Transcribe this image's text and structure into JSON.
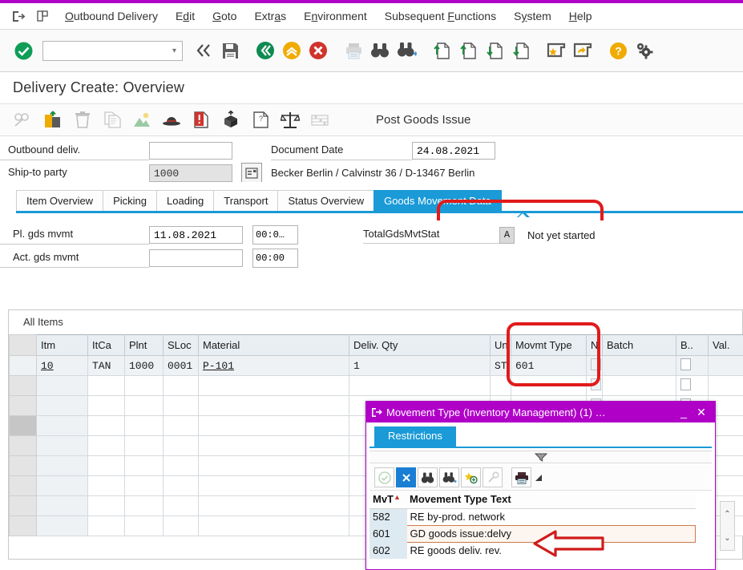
{
  "menu": {
    "icons": [
      "exit-icon",
      "new-session-icon"
    ],
    "items": [
      {
        "label": "Outbound Delivery",
        "accel": "O"
      },
      {
        "label": "Edit",
        "accel": "d"
      },
      {
        "label": "Goto",
        "accel": "G"
      },
      {
        "label": "Extras",
        "accel": "a"
      },
      {
        "label": "Environment",
        "accel": "n"
      },
      {
        "label": "Subsequent Functions",
        "accel": "F"
      },
      {
        "label": "System",
        "accel": "y"
      },
      {
        "label": "Help",
        "accel": "H"
      }
    ]
  },
  "toolbar": {
    "command_value": "",
    "command_placeholder": "",
    "icons": [
      "enter-check-icon",
      "command-field",
      "dropdown-caret-icon",
      "back-double-icon",
      "save-icon",
      "back-icon",
      "exit-up-icon",
      "cancel-icon",
      "print-icon",
      "find-icon",
      "find-next-icon",
      "first-page-icon",
      "previous-page-icon",
      "next-page-icon",
      "last-page-icon",
      "create-favorite-icon",
      "customize-local-layout-icon",
      "help-icon",
      "settings-gear-icon"
    ]
  },
  "page": {
    "title": "Delivery  Create: Overview",
    "app_toolbar_icons": [
      "display-change-icon",
      "package-out-icon",
      "delete-icon",
      "copy-document-icon",
      "picking-icon",
      "hat-icon",
      "incompletion-log-icon",
      "post-goods-issue-icon",
      "document-flow-icon",
      "scales-icon",
      "batch-split-icon"
    ],
    "post_goods_issue_label": "Post Goods Issue"
  },
  "header": {
    "outbound_deliv_label": "Outbound deliv.",
    "outbound_deliv_value": "",
    "ship_to_party_label": "Ship-to party",
    "ship_to_party_value": "1000",
    "partner_button_icon": "partner-detail-icon",
    "document_date_label": "Document Date",
    "document_date_value": "24.08.2021",
    "address_text": "Becker Berlin / Calvinstr 36 / D-13467 Berlin"
  },
  "tabs": {
    "items": [
      {
        "label": "Item Overview",
        "active": false
      },
      {
        "label": "Picking",
        "active": false
      },
      {
        "label": "Loading",
        "active": false
      },
      {
        "label": "Transport",
        "active": false
      },
      {
        "label": "Status Overview",
        "active": false
      },
      {
        "label": "Goods Movement Data",
        "active": true
      }
    ]
  },
  "goods_movement": {
    "planned_label": "Pl. gds mvmt",
    "planned_date": "11.08.2021",
    "planned_time": "00:0…",
    "actual_label": "Act. gds mvmt",
    "actual_date": "",
    "actual_time": "00:00",
    "total_status_label": "TotalGdsMvtStat",
    "total_status_code": "A",
    "total_status_text": "Not yet started"
  },
  "items_table": {
    "caption": "All Items",
    "columns": [
      "Itm",
      "ItCa",
      "Plnt",
      "SLoc",
      "Material",
      "Deliv. Qty",
      "Un",
      "Movmt Type",
      "N",
      "Batch",
      "B..",
      "Val."
    ],
    "rows": [
      {
        "itm": "10",
        "itca": "TAN",
        "plnt": "1000",
        "sloc": "0001",
        "material": "P-101",
        "qty": "1",
        "un": "ST",
        "movmt_type": "601",
        "n": "",
        "batch": "",
        "b": "",
        "val": ""
      }
    ],
    "empty_row_count": 8
  },
  "dialog": {
    "title": "Movement Type (Inventory Management) (1) …",
    "title_icon": "dialog-exit-icon",
    "minimize_label": "_",
    "close_label": "✕",
    "tab_label": "Restrictions",
    "toolbar_icons": [
      "check-icon",
      "cancel-selection-icon",
      "find-icon",
      "find-next-icon",
      "personal-value-list-icon",
      "insert-in-list-icon",
      "print-icon",
      "menu-caret-icon"
    ],
    "columns": [
      "MvT",
      "Movement Type Text"
    ],
    "sort_indicator": "▲",
    "rows": [
      {
        "mvt": "582",
        "text": "RE by-prod. network",
        "selected": false
      },
      {
        "mvt": "601",
        "text": "GD goods issue:delvy",
        "selected": true
      },
      {
        "mvt": "602",
        "text": "RE goods deliv. rev.",
        "selected": false
      }
    ],
    "scroll_up_icon": "scroll-up-icon",
    "scroll_down_icon": "scroll-down-icon"
  },
  "annotations": {
    "tab_highlight": "goods-movement-data-tab",
    "column_highlight": "movmt-type-column",
    "arrow_target": "movement-type-601-row",
    "color": "#e01b1b"
  }
}
